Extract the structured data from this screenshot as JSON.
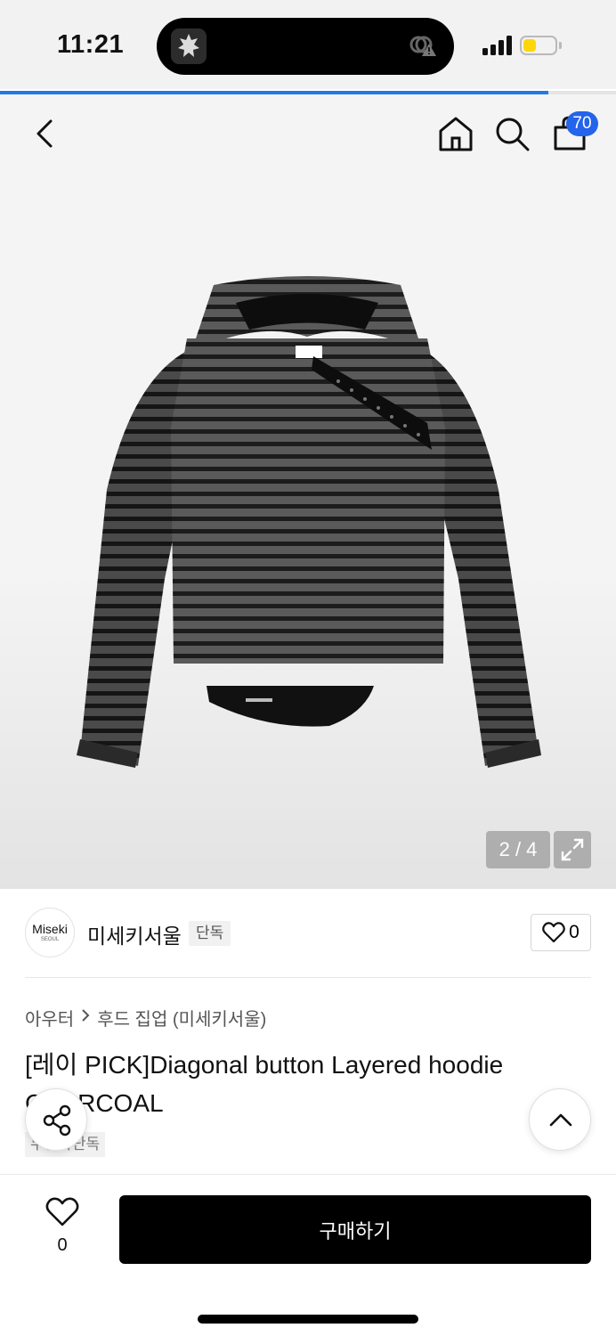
{
  "status_bar": {
    "time": "11:21",
    "battery_level": 0.4,
    "battery_color": "#ffd60a"
  },
  "page_load_progress": 0.89,
  "header": {
    "back_icon": "chevron-left-icon",
    "home_icon": "home-icon",
    "search_icon": "search-icon",
    "cart_icon": "shopping-bag-icon",
    "cart_count": "70",
    "accent_color": "#2463eb"
  },
  "gallery": {
    "counter": "2 / 4",
    "expand_icon": "expand-icon"
  },
  "brand": {
    "logo_text": "Miseki",
    "logo_sub": "SEOUL",
    "name": "미세키서울",
    "badge": "단독",
    "like_count": "0"
  },
  "product": {
    "category_parent": "아우터",
    "category_child": "후드 집업 (미세키서울)",
    "title": "[레이 PICK]Diagonal button Layered hoodie CHARCOAL",
    "tag": "무신사단독"
  },
  "bottom_bar": {
    "wish_count": "0",
    "buy_label": "구매하기"
  }
}
